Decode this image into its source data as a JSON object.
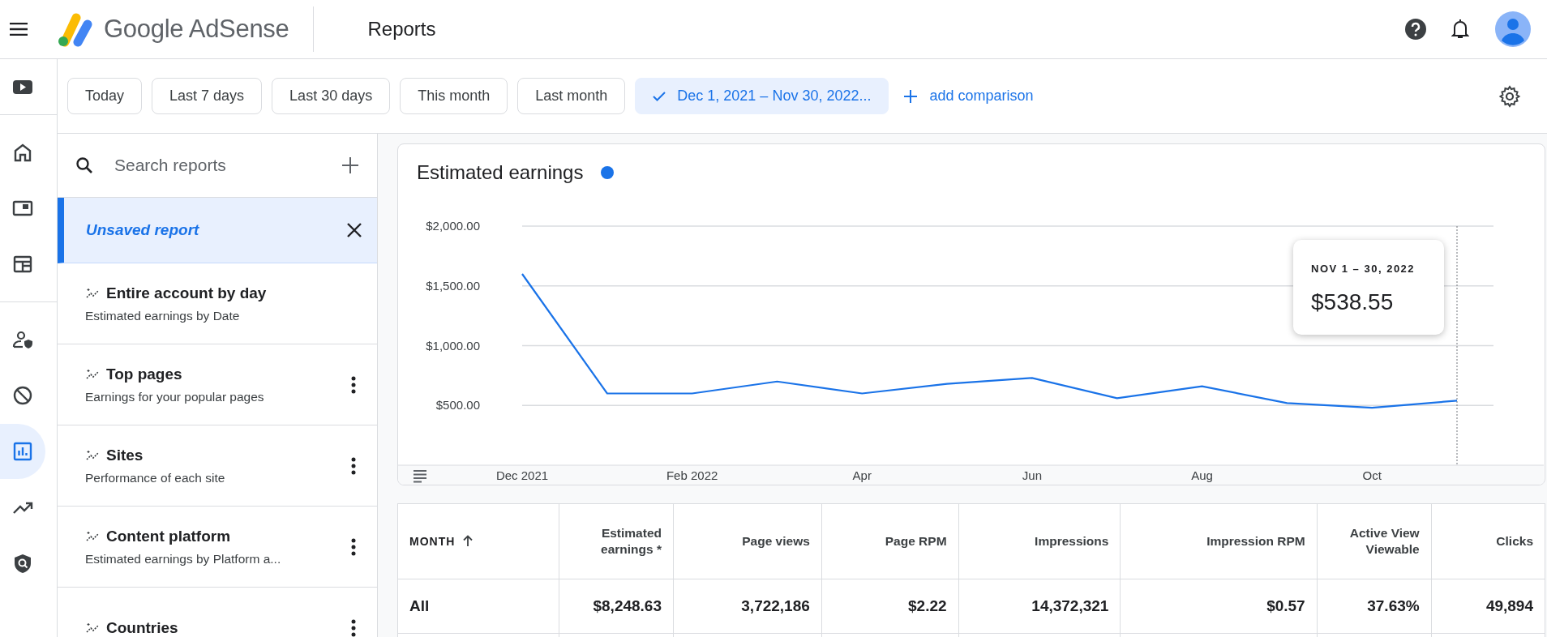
{
  "app": {
    "brand": "Google AdSense",
    "page_title": "Reports"
  },
  "nav": [
    {
      "kind": "youtube",
      "selected": false
    },
    {
      "kind": "home",
      "selected": false
    },
    {
      "kind": "ads",
      "selected": false
    },
    {
      "kind": "layout",
      "selected": false
    },
    {
      "kind": "privacy",
      "selected": false
    },
    {
      "kind": "block",
      "selected": false
    },
    {
      "kind": "reports",
      "selected": true
    },
    {
      "kind": "trend",
      "selected": false
    },
    {
      "kind": "policy",
      "selected": false
    }
  ],
  "date_ranges": [
    {
      "label": "Today",
      "selected": false
    },
    {
      "label": "Last 7 days",
      "selected": false
    },
    {
      "label": "Last 30 days",
      "selected": false
    },
    {
      "label": "This month",
      "selected": false
    },
    {
      "label": "Last month",
      "selected": false
    },
    {
      "label": "Dec 1, 2021 – Nov 30, 2022...",
      "selected": true
    }
  ],
  "add_comparison": "add comparison",
  "reports": {
    "search": {
      "placeholder": "Search reports"
    },
    "current": "Unsaved report",
    "items": [
      {
        "title": "Entire account by day",
        "subtitle": "Estimated earnings by Date",
        "menu": false
      },
      {
        "title": "Top pages",
        "subtitle": "Earnings for your popular pages",
        "menu": true
      },
      {
        "title": "Sites",
        "subtitle": "Performance of each site",
        "menu": true
      },
      {
        "title": "Content platform",
        "subtitle": "Estimated earnings by Platform a...",
        "menu": true
      },
      {
        "title": "Countries",
        "menu": true
      }
    ]
  },
  "chart": {
    "tooltip": {
      "date": "NOV 1 – 30, 2022",
      "value": "$538.55"
    },
    "chart_data": {
      "type": "line",
      "title": "Estimated earnings",
      "grid": true,
      "categories": [
        "Dec 2021",
        null,
        "Feb 2022",
        null,
        "Apr",
        null,
        "Jun",
        null,
        "Aug",
        null,
        "Oct",
        null
      ],
      "series": [
        {
          "color": "#1a73e8",
          "values": [
            1600,
            600,
            600,
            700,
            600,
            680,
            730,
            560,
            660,
            520,
            480,
            540
          ]
        }
      ],
      "ylim": [
        0,
        2000
      ],
      "yticks": [
        {
          "value": 500,
          "label": "$500.00"
        },
        {
          "value": 1000,
          "label": "$1,000.00"
        },
        {
          "value": 1500,
          "label": "$1,500.00"
        },
        {
          "value": 2000,
          "label": "$2,000.00"
        }
      ]
    }
  },
  "table": {
    "columns": [
      {
        "label": "MONTH",
        "sorted": true
      },
      {
        "label": "Estimated earnings *",
        "sorted": false
      },
      {
        "label": "Page views",
        "sorted": false
      },
      {
        "label": "Page RPM",
        "sorted": false
      },
      {
        "label": "Impressions",
        "sorted": false
      },
      {
        "label": "Impression RPM",
        "sorted": false
      },
      {
        "label": "Active View Viewable",
        "sorted": false
      },
      {
        "label": "Clicks",
        "sorted": false
      }
    ],
    "rows": [
      [
        "All",
        "$8,248.63",
        "3,722,186",
        "$2.22",
        "14,372,321",
        "$0.57",
        "37.63%",
        "49,894"
      ]
    ]
  }
}
